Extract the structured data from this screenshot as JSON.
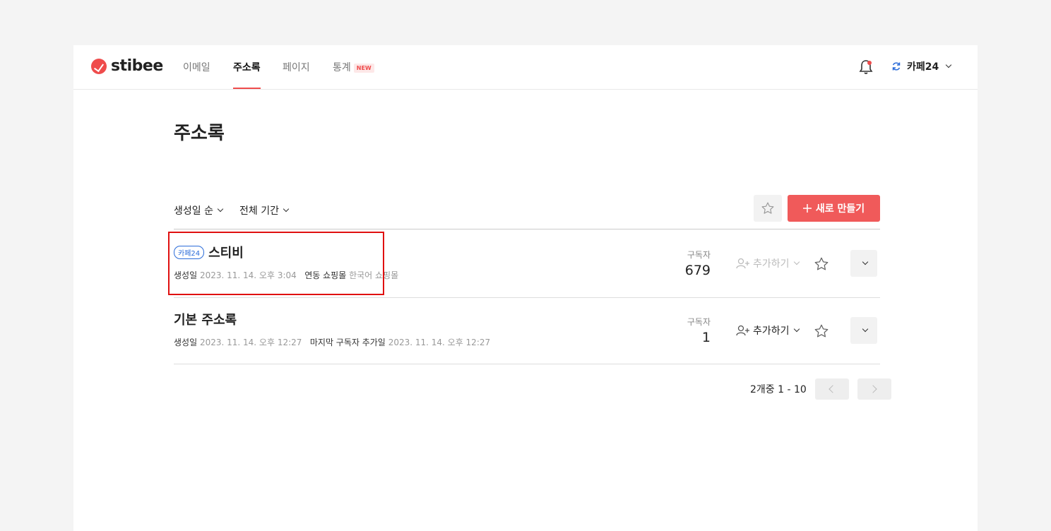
{
  "brand": {
    "name": "stibee",
    "accent": "#ef4c4c"
  },
  "nav": {
    "tabs": [
      {
        "label": "이메일"
      },
      {
        "label": "주소록"
      },
      {
        "label": "페이지"
      },
      {
        "label": "통계",
        "badge": "NEW"
      }
    ],
    "active_tab": "주소록"
  },
  "account": {
    "label": "카페24"
  },
  "page": {
    "title": "주소록"
  },
  "filters": {
    "sort": "생성일 순",
    "period": "전체 기간"
  },
  "actions": {
    "new_label": "새로 만들기"
  },
  "lists": [
    {
      "tag": "카페24",
      "name": "스티비",
      "meta1_label": "생성일",
      "meta1_value": "2023. 11. 14. 오후 3:04",
      "meta2_label": "연동 쇼핑몰",
      "meta2_value": "한국어 쇼핑몰",
      "subscribers_label": "구독자",
      "subscribers": "679",
      "add_label": "추가하기",
      "add_enabled": false
    },
    {
      "name": "기본 주소록",
      "meta1_label": "생성일",
      "meta1_value": "2023. 11. 14. 오후 12:27",
      "meta2_label": "마지막 구독자 추가일",
      "meta2_value": "2023. 11. 14. 오후 12:27",
      "subscribers_label": "구독자",
      "subscribers": "1",
      "add_label": "추가하기",
      "add_enabled": true
    }
  ],
  "pagination": {
    "summary": "2개중 1 - 10"
  }
}
